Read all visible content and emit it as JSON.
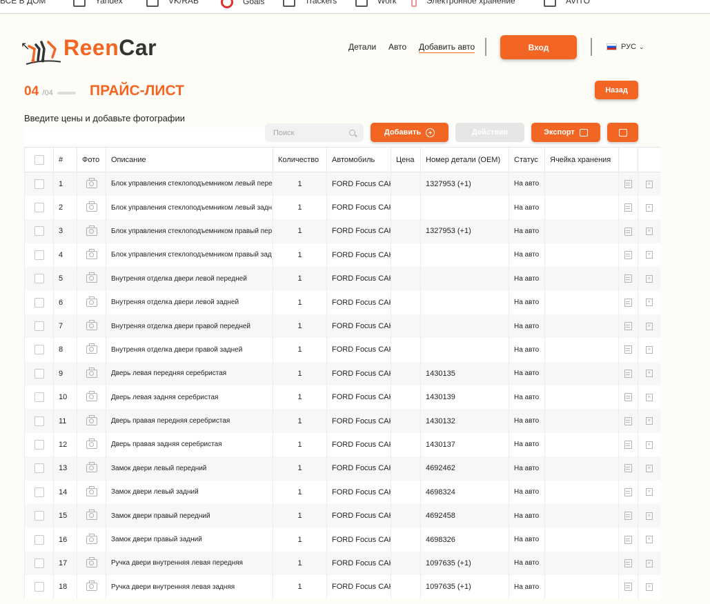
{
  "bookmarks": [
    {
      "label": "ВСЕ В ДОМ",
      "icon": "app-icon"
    },
    {
      "label": "Yandex",
      "icon": "folder-icon"
    },
    {
      "label": "VK/RAB",
      "icon": "folder-icon"
    },
    {
      "label": "Goals",
      "icon": "target-icon"
    },
    {
      "label": "Trackers",
      "icon": "folder-icon"
    },
    {
      "label": "Work",
      "icon": "folder-icon"
    },
    {
      "label": "Электронное хранение",
      "icon": "doc-icon"
    },
    {
      "label": "AVITO",
      "icon": "folder-icon"
    }
  ],
  "brand": {
    "part1": "Reen",
    "part2": "Car",
    "accent": "#f26522"
  },
  "header": {
    "nav": [
      "Детали",
      "Авто",
      "Добавить авто"
    ],
    "login": "Вход",
    "lang": "РУС"
  },
  "step": {
    "current": "04",
    "total": "/04"
  },
  "title": "ПРАЙС-ЛИСТ",
  "back": "Назад",
  "subtitle": "Введите цены и добавьте фотографии",
  "toolbar": {
    "search_placeholder": "Поиск",
    "add": "Добавить",
    "actions": "Действия",
    "export": "Экспорт"
  },
  "columns": [
    "#",
    "Фото",
    "Описание",
    "Количество",
    "Автомобиль",
    "Цена",
    "Номер детали (OEM)",
    "Статус",
    "Ячейка хранения"
  ],
  "rows": [
    {
      "n": "1",
      "desc": "Блок управления стеклоподъемником левый пере",
      "qty": "1",
      "car": "FORD Focus CAK",
      "price": "",
      "oem": "1327953 (+1)",
      "status": "На авто",
      "cell": ""
    },
    {
      "n": "2",
      "desc": "Блок управления стеклоподъемником левый задн",
      "qty": "1",
      "car": "FORD Focus CAK",
      "price": "",
      "oem": "",
      "status": "На авто",
      "cell": ""
    },
    {
      "n": "3",
      "desc": "Блок управления стеклоподъемником правый пер",
      "qty": "1",
      "car": "FORD Focus CAK",
      "price": "",
      "oem": "1327953 (+1)",
      "status": "На авто",
      "cell": ""
    },
    {
      "n": "4",
      "desc": "Блок управления стеклоподъемником правый зад",
      "qty": "1",
      "car": "FORD Focus CAK",
      "price": "",
      "oem": "",
      "status": "На авто",
      "cell": ""
    },
    {
      "n": "5",
      "desc": "Внутреняя отделка двери левой передней",
      "qty": "1",
      "car": "FORD Focus CAK",
      "price": "",
      "oem": "",
      "status": "На авто",
      "cell": ""
    },
    {
      "n": "6",
      "desc": "Внутреняя отделка двери левой задней",
      "qty": "1",
      "car": "FORD Focus CAK",
      "price": "",
      "oem": "",
      "status": "На авто",
      "cell": ""
    },
    {
      "n": "7",
      "desc": "Внутреняя отделка двери правой передней",
      "qty": "1",
      "car": "FORD Focus CAK",
      "price": "",
      "oem": "",
      "status": "На авто",
      "cell": ""
    },
    {
      "n": "8",
      "desc": "Внутреняя отделка двери правой задней",
      "qty": "1",
      "car": "FORD Focus CAK",
      "price": "",
      "oem": "",
      "status": "На авто",
      "cell": ""
    },
    {
      "n": "9",
      "desc": "Дверь левая передняя серебристая",
      "qty": "1",
      "car": "FORD Focus CAK",
      "price": "",
      "oem": "1430135",
      "status": "На авто",
      "cell": ""
    },
    {
      "n": "10",
      "desc": "Дверь левая задняя серебристая",
      "qty": "1",
      "car": "FORD Focus CAK",
      "price": "",
      "oem": "1430139",
      "status": "На авто",
      "cell": ""
    },
    {
      "n": "11",
      "desc": "Дверь правая передняя серебристая",
      "qty": "1",
      "car": "FORD Focus CAK",
      "price": "",
      "oem": "1430132",
      "status": "На авто",
      "cell": ""
    },
    {
      "n": "12",
      "desc": "Дверь правая задняя серебристая",
      "qty": "1",
      "car": "FORD Focus CAK",
      "price": "",
      "oem": "1430137",
      "status": "На авто",
      "cell": ""
    },
    {
      "n": "13",
      "desc": "Замок двери левый передний",
      "qty": "1",
      "car": "FORD Focus CAK",
      "price": "",
      "oem": "4692462",
      "status": "На авто",
      "cell": ""
    },
    {
      "n": "14",
      "desc": "Замок двери левый задний",
      "qty": "1",
      "car": "FORD Focus CAK",
      "price": "",
      "oem": "4698324",
      "status": "На авто",
      "cell": ""
    },
    {
      "n": "15",
      "desc": "Замок двери правый передний",
      "qty": "1",
      "car": "FORD Focus CAK",
      "price": "",
      "oem": "4692458",
      "status": "На авто",
      "cell": ""
    },
    {
      "n": "16",
      "desc": "Замок двери правый задний",
      "qty": "1",
      "car": "FORD Focus CAK",
      "price": "",
      "oem": "4698326",
      "status": "На авто",
      "cell": ""
    },
    {
      "n": "17",
      "desc": "Ручка двери внутренняя левая передняя",
      "qty": "1",
      "car": "FORD Focus CAK",
      "price": "",
      "oem": "1097635 (+1)",
      "status": "На авто",
      "cell": ""
    },
    {
      "n": "18",
      "desc": "Ручка двери внутренняя левая задняя",
      "qty": "1",
      "car": "FORD Focus CAK",
      "price": "",
      "oem": "1097635 (+1)",
      "status": "На авто",
      "cell": ""
    }
  ]
}
